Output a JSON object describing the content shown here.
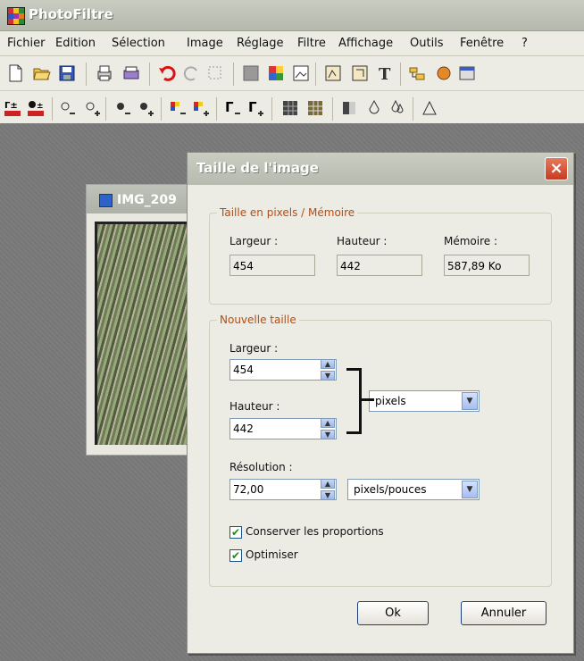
{
  "app": {
    "title": "PhotoFiltre"
  },
  "menu": [
    "Fichier",
    "Edition",
    "Sélection",
    "Image",
    "Réglage",
    "Filtre",
    "Affichage",
    "Outils",
    "Fenêtre",
    "?"
  ],
  "image_window": {
    "title": "IMG_209"
  },
  "dialog": {
    "title": "Taille de l'image",
    "pixel_group": {
      "label": "Taille en pixels / Mémoire",
      "width_label": "Largeur :",
      "width_value": "454",
      "height_label": "Hauteur :",
      "height_value": "442",
      "memory_label": "Mémoire :",
      "memory_value": "587,89 Ko"
    },
    "new_size": {
      "label": "Nouvelle taille",
      "width_label": "Largeur :",
      "width_value": "454",
      "height_label": "Hauteur :",
      "height_value": "442",
      "unit_value": "pixels",
      "resolution_label": "Résolution :",
      "resolution_value": "72,00",
      "resolution_unit": "pixels/pouces"
    },
    "keep_proportions": {
      "label": "Conserver les proportions",
      "checked": true
    },
    "optimize": {
      "label": "Optimiser",
      "checked": true
    },
    "ok_label": "Ok",
    "cancel_label": "Annuler"
  }
}
